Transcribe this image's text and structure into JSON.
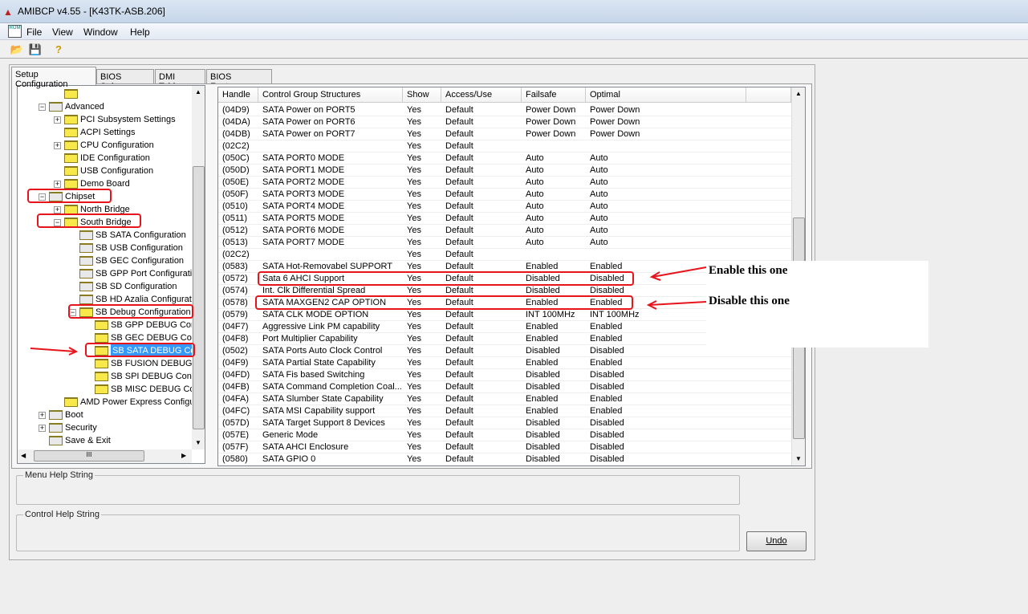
{
  "window": {
    "title": "AMIBCP v4.55 - [K43TK-ASB.206]"
  },
  "menu": [
    "File",
    "View",
    "Window",
    "Help"
  ],
  "toolbar": {
    "icons": [
      "open-folder-icon",
      "save-icon",
      "help-icon"
    ]
  },
  "tabs": [
    "Setup Configuration",
    "BIOS Strings",
    "DMI Tables",
    "BIOS Features"
  ],
  "tree": [
    {
      "label": "",
      "level": 1,
      "exp": ""
    },
    {
      "label": "Advanced",
      "level": 0,
      "exp": "-"
    },
    {
      "label": "PCI Subsystem Settings",
      "level": 1,
      "exp": "+"
    },
    {
      "label": "ACPI Settings",
      "level": 1,
      "exp": ""
    },
    {
      "label": "CPU Configuration",
      "level": 1,
      "exp": "+"
    },
    {
      "label": "IDE Configuration",
      "level": 1,
      "exp": ""
    },
    {
      "label": "USB Configuration",
      "level": 1,
      "exp": ""
    },
    {
      "label": "Demo Board",
      "level": 1,
      "exp": "+"
    },
    {
      "label": "Chipset",
      "level": 0,
      "exp": "-"
    },
    {
      "label": "North Bridge",
      "level": 1,
      "exp": "+"
    },
    {
      "label": "South Bridge",
      "level": 1,
      "exp": "-"
    },
    {
      "label": "SB SATA Configuration",
      "level": 2,
      "exp": ""
    },
    {
      "label": "SB USB Configuration",
      "level": 2,
      "exp": ""
    },
    {
      "label": "SB GEC Configuration",
      "level": 2,
      "exp": ""
    },
    {
      "label": "SB GPP Port Configuratio",
      "level": 2,
      "exp": ""
    },
    {
      "label": "SB SD Configuration",
      "level": 2,
      "exp": ""
    },
    {
      "label": "SB HD Azalia Configurati",
      "level": 2,
      "exp": ""
    },
    {
      "label": "SB Debug Configuration",
      "level": 2,
      "exp": "-"
    },
    {
      "label": "SB GPP DEBUG Conf",
      "level": 3,
      "exp": ""
    },
    {
      "label": "SB GEC DEBUG Conf",
      "level": 3,
      "exp": ""
    },
    {
      "label": "SB SATA DEBUG Co",
      "level": 3,
      "exp": "",
      "selected": true
    },
    {
      "label": "SB FUSION DEBUG C",
      "level": 3,
      "exp": ""
    },
    {
      "label": "SB SPI DEBUG Config",
      "level": 3,
      "exp": ""
    },
    {
      "label": "SB MISC DEBUG Con",
      "level": 3,
      "exp": ""
    },
    {
      "label": "AMD Power Express Configu",
      "level": 1,
      "exp": ""
    },
    {
      "label": "Boot",
      "level": 0,
      "exp": "+"
    },
    {
      "label": "Security",
      "level": 0,
      "exp": "+"
    },
    {
      "label": "Save & Exit",
      "level": 0,
      "exp": ""
    }
  ],
  "table": {
    "columns": [
      "Handle",
      "Control Group Structures",
      "Show",
      "Access/Use",
      "Failsafe",
      "Optimal"
    ],
    "rows": [
      [
        "(04D9)",
        "SATA Power on PORT5",
        "Yes",
        "Default",
        "Power Down",
        "Power Down"
      ],
      [
        "(04DA)",
        "SATA Power on PORT6",
        "Yes",
        "Default",
        "Power Down",
        "Power Down"
      ],
      [
        "(04DB)",
        "SATA Power on PORT7",
        "Yes",
        "Default",
        "Power Down",
        "Power Down"
      ],
      [
        "(02C2)",
        "",
        "Yes",
        "Default",
        "",
        ""
      ],
      [
        "(050C)",
        "SATA PORT0 MODE",
        "Yes",
        "Default",
        "Auto",
        "Auto"
      ],
      [
        "(050D)",
        "SATA PORT1 MODE",
        "Yes",
        "Default",
        "Auto",
        "Auto"
      ],
      [
        "(050E)",
        "SATA PORT2 MODE",
        "Yes",
        "Default",
        "Auto",
        "Auto"
      ],
      [
        "(050F)",
        "SATA PORT3 MODE",
        "Yes",
        "Default",
        "Auto",
        "Auto"
      ],
      [
        "(0510)",
        "SATA PORT4 MODE",
        "Yes",
        "Default",
        "Auto",
        "Auto"
      ],
      [
        "(0511)",
        "SATA PORT5 MODE",
        "Yes",
        "Default",
        "Auto",
        "Auto"
      ],
      [
        "(0512)",
        "SATA PORT6 MODE",
        "Yes",
        "Default",
        "Auto",
        "Auto"
      ],
      [
        "(0513)",
        "SATA PORT7 MODE",
        "Yes",
        "Default",
        "Auto",
        "Auto"
      ],
      [
        "(02C2)",
        "",
        "Yes",
        "Default",
        "",
        ""
      ],
      [
        "(0583)",
        " SATA Hot-Removabel SUPPORT",
        "Yes",
        "Default",
        "Enabled",
        "Enabled"
      ],
      [
        "(0572)",
        "Sata 6 AHCI Support",
        "Yes",
        "Default",
        "Disabled",
        "Disabled"
      ],
      [
        "(0574)",
        "Int. Clk Differential Spread",
        "Yes",
        "Default",
        "Disabled",
        "Disabled"
      ],
      [
        "(0578)",
        "SATA MAXGEN2 CAP OPTION",
        "Yes",
        "Default",
        "Enabled",
        "Enabled"
      ],
      [
        "(0579)",
        "SATA CLK MODE OPTION",
        "Yes",
        "Default",
        "INT 100MHz",
        "INT 100MHz"
      ],
      [
        "(04F7)",
        "Aggressive Link PM capability",
        "Yes",
        "Default",
        "Enabled",
        "Enabled"
      ],
      [
        "(04F8)",
        "Port Multiplier Capability",
        "Yes",
        "Default",
        "Enabled",
        "Enabled"
      ],
      [
        "(0502)",
        "SATA Ports Auto Clock Control",
        "Yes",
        "Default",
        "Disabled",
        "Disabled"
      ],
      [
        "(04F9)",
        "SATA Partial State Capability",
        "Yes",
        "Default",
        "Enabled",
        "Enabled"
      ],
      [
        "(04FD)",
        "SATA Fis based Switching",
        "Yes",
        "Default",
        "Disabled",
        "Disabled"
      ],
      [
        "(04FB)",
        "SATA Command Completion Coal...",
        "Yes",
        "Default",
        "Disabled",
        "Disabled"
      ],
      [
        "(04FA)",
        "SATA Slumber State Capability",
        "Yes",
        "Default",
        "Enabled",
        "Enabled"
      ],
      [
        "(04FC)",
        "SATA MSI Capability support",
        "Yes",
        "Default",
        "Enabled",
        "Enabled"
      ],
      [
        "(057D)",
        "SATA Target Support 8 Devices",
        "Yes",
        "Default",
        "Disabled",
        "Disabled"
      ],
      [
        "(057E)",
        "Generic Mode",
        "Yes",
        "Default",
        "Disabled",
        "Disabled"
      ],
      [
        "(057F)",
        "SATA AHCI Enclosure",
        "Yes",
        "Default",
        "Disabled",
        "Disabled"
      ],
      [
        "(0580)",
        "SATA GPIO 0",
        "Yes",
        "Default",
        "Disabled",
        "Disabled"
      ]
    ]
  },
  "help": {
    "menu_help_label": "Menu Help String",
    "control_help_label": "Control Help String"
  },
  "undo_label": "Undo",
  "annotations": {
    "enable": "Enable this one",
    "disable": "Disable this one",
    "color": "#e8141c"
  }
}
